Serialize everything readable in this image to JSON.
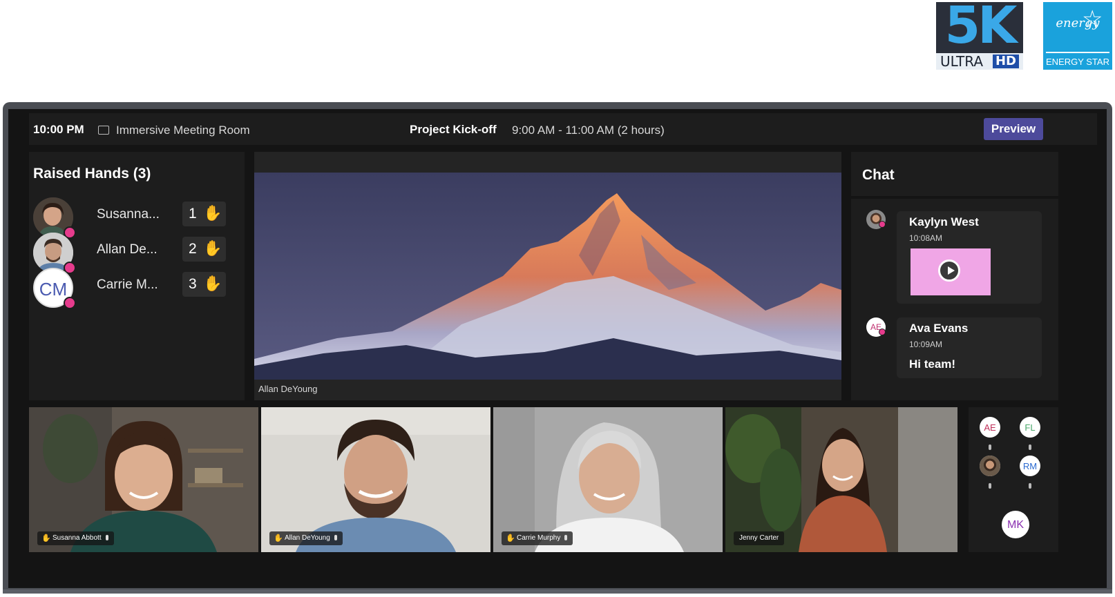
{
  "badges": {
    "resolution": {
      "big": "5K",
      "ultra": "ULTRA",
      "hd": "HD"
    },
    "energy_star": {
      "script": "energy",
      "label": "ENERGY STAR"
    }
  },
  "topbar": {
    "time": "10:00 PM",
    "room_icon": "screen-share-icon",
    "room": "Immersive Meeting Room",
    "meeting_title": "Project Kick-off",
    "meeting_time": "9:00 AM - 11:00 AM (2 hours)",
    "preview_label": "Preview",
    "preview_color": "#4d4a9b"
  },
  "raised_hands": {
    "title": "Raised Hands (3)",
    "items": [
      {
        "name": "Susanna...",
        "order": "1",
        "avatar": "photo"
      },
      {
        "name": "Allan De...",
        "order": "2",
        "avatar": "photo"
      },
      {
        "name": "Carrie M...",
        "order": "3",
        "initials": "CM"
      }
    ]
  },
  "main_video": {
    "caption": "Allan DeYoung"
  },
  "chat": {
    "title": "Chat",
    "messages": [
      {
        "author": "Kaylyn West",
        "time": "10:08AM",
        "attachment": "video"
      },
      {
        "author": "Ava Evans",
        "time": "10:09AM",
        "initials": "AE",
        "text": "Hi team!"
      }
    ]
  },
  "tiles": [
    {
      "name": "Susanna Abbott",
      "raised": true
    },
    {
      "name": "Allan DeYoung",
      "raised": true
    },
    {
      "name": "Carrie Murphy",
      "raised": true
    },
    {
      "name": "Jenny Carter",
      "raised": false
    }
  ],
  "side_participants": [
    {
      "initials": "AE"
    },
    {
      "initials": "FL"
    },
    {
      "initials": "",
      "avatar": "photo"
    },
    {
      "initials": "RM"
    },
    {
      "initials": "MK"
    }
  ],
  "colors": {
    "raised_hand_highlight": "#e8c62a",
    "presence_dot": "#e63b8c",
    "hand_icon": "#f5c242"
  }
}
